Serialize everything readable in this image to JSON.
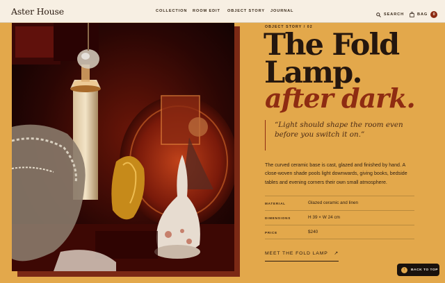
{
  "brand": "Aster House",
  "nav": {
    "links": [
      "COLLECTION",
      "ROOM EDIT",
      "OBJECT STORY",
      "JOURNAL"
    ],
    "search_label": "SEARCH",
    "bag_label": "BAG",
    "bag_count": "0"
  },
  "hero_image": {
    "alt": "Porcelain lamp, crystal finial, brass figurine and ceramic bell in a dim red room"
  },
  "story": {
    "eyebrow": "OBJECT STORY / 02",
    "title_line1": "The Fold",
    "title_line2": "Lamp.",
    "title_line3": "after dark.",
    "quote_line1": "“Light should shape the room even",
    "quote_line2": "before you switch it on.”",
    "body": "The curved ceramic base is cast, glazed and finished by hand. A close-woven shade pools light downwards, giving books, bedside tables and evening corners their own small atmosphere."
  },
  "specs": [
    {
      "label": "MATERIAL",
      "value": "Glazed ceramic and linen"
    },
    {
      "label": "DIMENSIONS",
      "value": "H 39 × W 24 cm"
    },
    {
      "label": "PRICE",
      "value": "$240"
    }
  ],
  "cta": {
    "label": "MEET THE FOLD LAMP",
    "arrow": "↗"
  },
  "back_to_top": {
    "label": "BACK TO TOP",
    "icon": "↑"
  },
  "colors": {
    "page": "#e3a84b",
    "nav": "#f7efe3",
    "accent": "#8e2c12",
    "ink": "#24160e",
    "button": "#1a120d"
  }
}
